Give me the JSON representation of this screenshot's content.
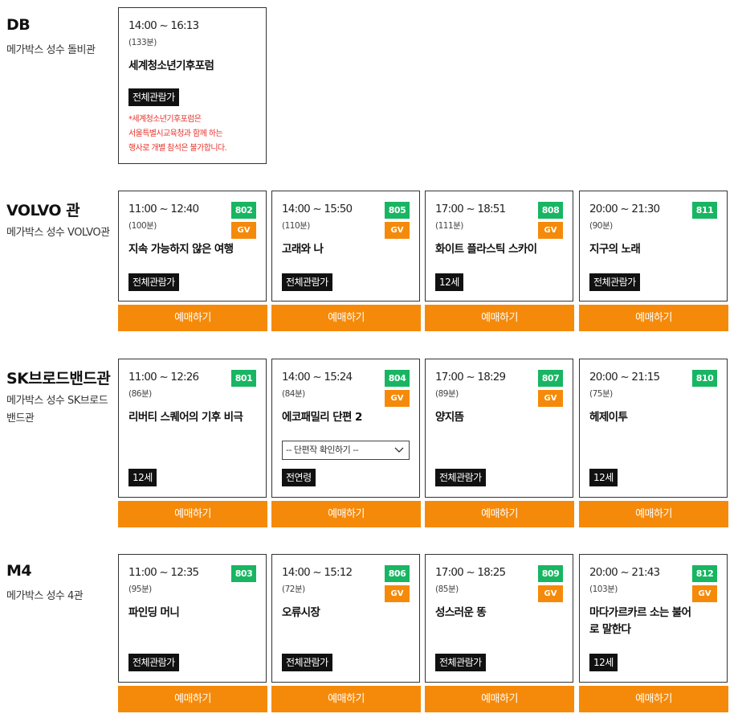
{
  "halls": [
    {
      "name": "DB",
      "desc": "메가박스 성수 돌비관",
      "shows": [
        {
          "time": "14:00 ~ 16:13",
          "runtime": "(133분)",
          "title": "세계청소년기후포럼",
          "rating": "전체관람가",
          "notice": "*세계청소년기후포럼은\n서울특별시교육청과 함께 하는\n행사로 개별 참석은 불가합니다."
        }
      ]
    },
    {
      "name": "VOLVO 관",
      "desc": "메가박스 성수 VOLVO관",
      "shows": [
        {
          "time": "11:00 ~ 12:40",
          "runtime": "(100분)",
          "title": "지속 가능하지 않은 여행",
          "rating": "전체관람가",
          "no": "802",
          "gv": "GV",
          "book": "예매하기"
        },
        {
          "time": "14:00 ~ 15:50",
          "runtime": "(110분)",
          "title": "고래와 나",
          "rating": "전체관람가",
          "no": "805",
          "gv": "GV",
          "book": "예매하기"
        },
        {
          "time": "17:00 ~ 18:51",
          "runtime": "(111분)",
          "title": "화이트 플라스틱 스카이",
          "rating": "12세",
          "no": "808",
          "gv": "GV",
          "book": "예매하기"
        },
        {
          "time": "20:00 ~ 21:30",
          "runtime": "(90분)",
          "title": "지구의 노래",
          "rating": "전체관람가",
          "no": "811",
          "book": "예매하기"
        }
      ]
    },
    {
      "name": "SK브로드밴드관",
      "desc": "메가박스 성수 SK브로드밴드관",
      "shows": [
        {
          "time": "11:00 ~ 12:26",
          "runtime": "(86분)",
          "title": "리버티 스퀘어의 기후 비극",
          "rating": "12세",
          "no": "801",
          "book": "예매하기"
        },
        {
          "time": "14:00 ~ 15:24",
          "runtime": "(84분)",
          "title": "에코패밀리 단편 2",
          "rating": "전연령",
          "no": "804",
          "gv": "GV",
          "book": "예매하기",
          "select": "-- 단편작 확인하기 --"
        },
        {
          "time": "17:00 ~ 18:29",
          "runtime": "(89분)",
          "title": "양지뜸",
          "rating": "전체관람가",
          "no": "807",
          "gv": "GV",
          "book": "예매하기"
        },
        {
          "time": "20:00 ~ 21:15",
          "runtime": "(75분)",
          "title": "헤제이투",
          "rating": "12세",
          "no": "810",
          "book": "예매하기"
        }
      ]
    },
    {
      "name": "M4",
      "desc": "메가박스 성수 4관",
      "shows": [
        {
          "time": "11:00 ~ 12:35",
          "runtime": "(95분)",
          "title": "파인딩 머니",
          "rating": "전체관람가",
          "no": "803",
          "book": "예매하기"
        },
        {
          "time": "14:00 ~ 15:12",
          "runtime": "(72분)",
          "title": "오류시장",
          "rating": "전체관람가",
          "no": "806",
          "gv": "GV",
          "book": "예매하기"
        },
        {
          "time": "17:00 ~ 18:25",
          "runtime": "(85분)",
          "title": "성스러운 똥",
          "rating": "전체관람가",
          "no": "809",
          "gv": "GV",
          "book": "예매하기"
        },
        {
          "time": "20:00 ~ 21:43",
          "runtime": "(103분)",
          "title": "마다가르카르 소는 불어로 말한다",
          "rating": "12세",
          "no": "812",
          "gv": "GV",
          "book": "예매하기"
        }
      ]
    }
  ]
}
